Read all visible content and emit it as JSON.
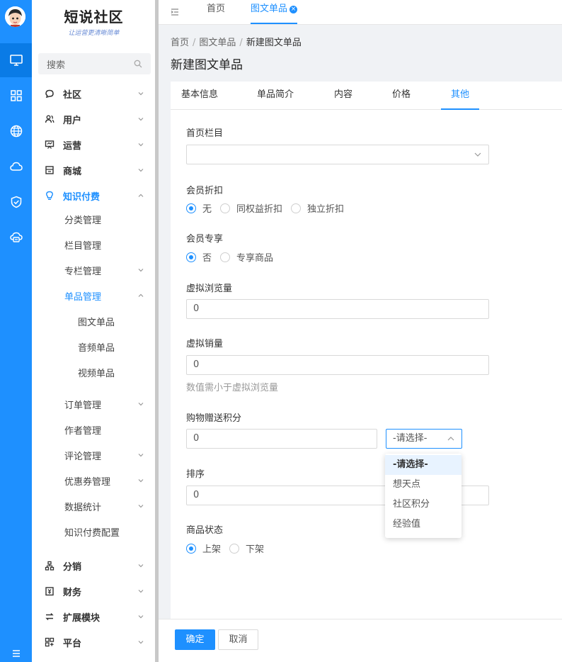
{
  "colors": {
    "primary": "#1e90ff",
    "rail": "#1e90ff",
    "rail_active": "#0a7be6"
  },
  "rail": {
    "icons": [
      "avatar",
      "monitor-icon",
      "grid-icon",
      "globe-icon",
      "cloud-icon",
      "shield-check-icon",
      "cloud-server-icon"
    ]
  },
  "logo": {
    "title": "短说社区",
    "slogan": "让运营更清晰简单"
  },
  "search": {
    "placeholder": "搜索"
  },
  "menu": {
    "community": "社区",
    "users": "用户",
    "operations": "运营",
    "mall": "商城",
    "knowledge_pay": "知识付费",
    "category_mgmt": "分类管理",
    "column_mgmt": "栏目管理",
    "special_mgmt": "专栏管理",
    "single_mgmt": "单品管理",
    "graphic_single": "图文单品",
    "audio_single": "音频单品",
    "video_single": "视频单品",
    "order_mgmt": "订单管理",
    "author_mgmt": "作者管理",
    "comment_mgmt": "评论管理",
    "coupon_mgmt": "优惠券管理",
    "data_stats": "数据统计",
    "knowledge_config": "知识付费配置",
    "distribution": "分销",
    "finance": "财务",
    "extensions": "扩展模块",
    "platform": "平台"
  },
  "topbar": {
    "tabs": [
      {
        "label": "首页"
      },
      {
        "label": "图文单品",
        "close": "×"
      }
    ]
  },
  "breadcrumb": {
    "items": [
      "首页",
      "图文单品",
      "新建图文单品"
    ],
    "sep": "/"
  },
  "page": {
    "title": "新建图文单品"
  },
  "form_tabs": [
    "基本信息",
    "单品简介",
    "内容",
    "价格",
    "其他"
  ],
  "form": {
    "homepage_column": {
      "label": "首页栏目",
      "value": ""
    },
    "member_discount": {
      "label": "会员折扣",
      "options": [
        "无",
        "同权益折扣",
        "独立折扣"
      ],
      "selected": "无"
    },
    "member_exclusive": {
      "label": "会员专享",
      "options": [
        "否",
        "专享商品"
      ],
      "selected": "否"
    },
    "virtual_views": {
      "label": "虚拟浏览量",
      "value": "0"
    },
    "virtual_sales": {
      "label": "虚拟销量",
      "value": "0",
      "hint": "数值需小于虚拟浏览量"
    },
    "purchase_points": {
      "label": "购物赠送积分",
      "value": "0",
      "select_value": "-请选择-"
    },
    "sort": {
      "label": "排序",
      "value": "0"
    },
    "status": {
      "label": "商品状态",
      "options": [
        "上架",
        "下架"
      ],
      "selected": "上架"
    }
  },
  "dropdown": {
    "options": [
      "-请选择-",
      "想天点",
      "社区积分",
      "经验值"
    ],
    "selected": "-请选择-"
  },
  "footer": {
    "confirm": "确定",
    "cancel": "取消"
  }
}
